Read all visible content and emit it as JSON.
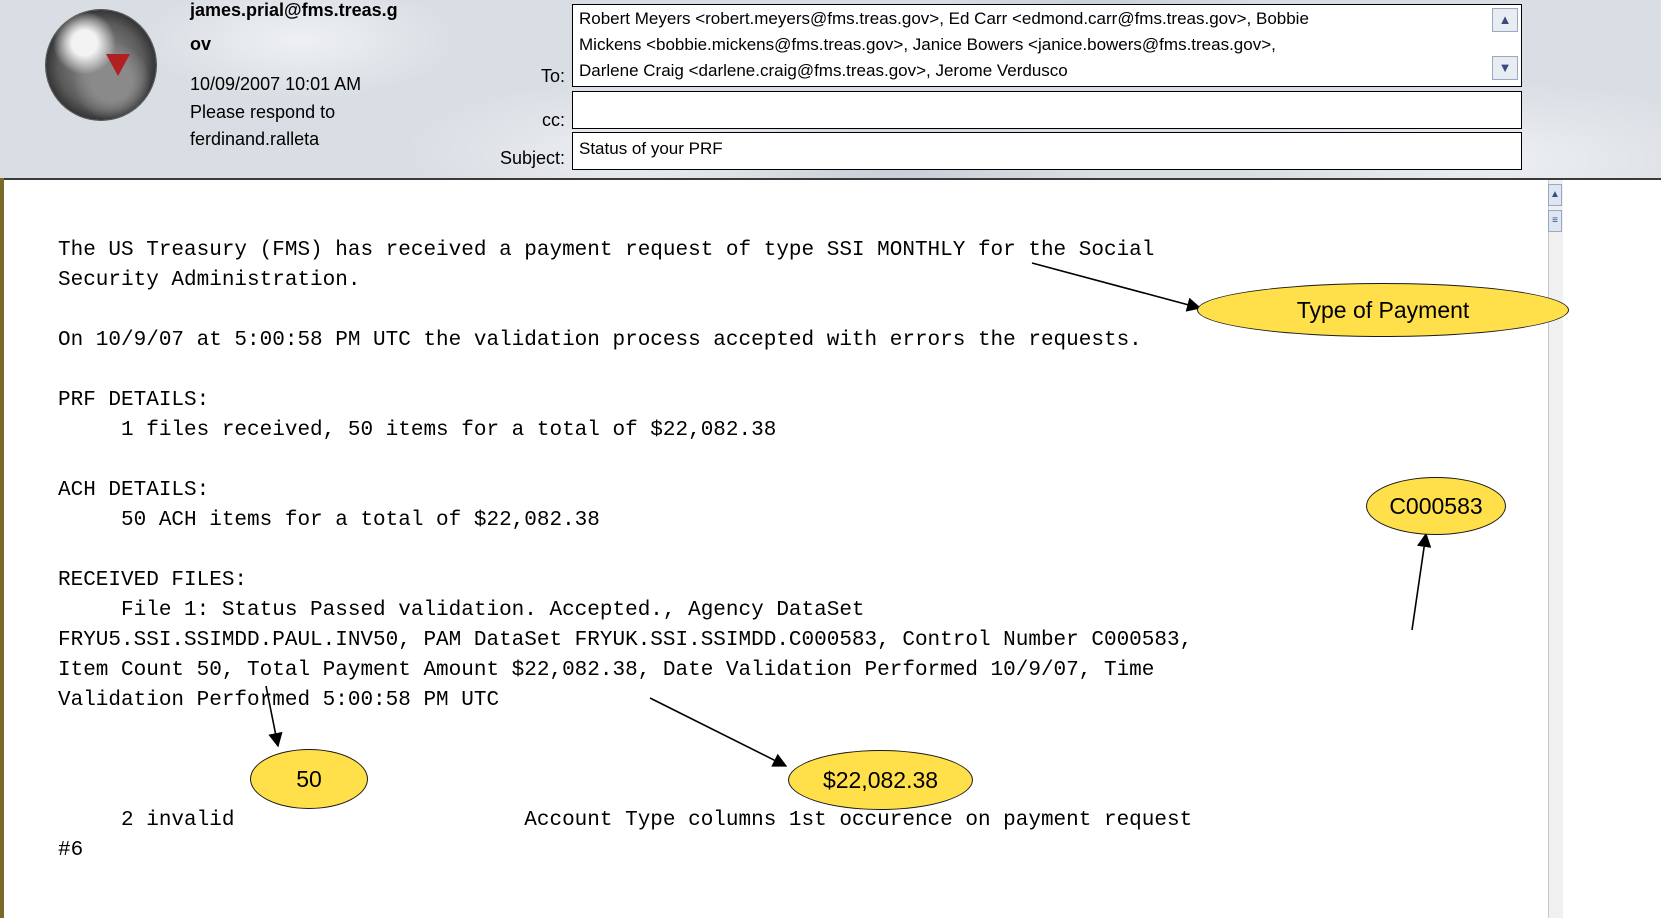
{
  "header": {
    "sender_line1": "james.prial@fms.treas.g",
    "sender_line2": "ov",
    "datetime": "10/09/2007 10:01 AM",
    "respond_to_line1": "Please respond to",
    "respond_to_line2": "ferdinand.ralleta",
    "to_label": "To:",
    "cc_label": "cc:",
    "subject_label": "Subject:",
    "to_lines": [
      "Robert Meyers <robert.meyers@fms.treas.gov>, Ed Carr <edmond.carr@fms.treas.gov>, Bobbie",
      "Mickens <bobbie.mickens@fms.treas.gov>, Janice Bowers <janice.bowers@fms.treas.gov>,",
      "Darlene Craig <darlene.craig@fms.treas.gov>, Jerome Verdusco"
    ],
    "cc_value": "",
    "subject_value": "Status of your PRF"
  },
  "message": {
    "lines": [
      "The US Treasury (FMS) has received a payment request of type SSI MONTHLY for the Social",
      "Security Administration.",
      "On 10/9/07 at 5:00:58 PM UTC the validation process accepted with errors the requests.",
      "PRF DETAILS:",
      "     1 files received, 50 items for a total of $22,082.38",
      "ACH DETAILS:",
      "     50 ACH items for a total of $22,082.38",
      "RECEIVED FILES:",
      "     File 1: Status Passed validation. Accepted., Agency DataSet",
      "FRYU5.SSI.SSIMDD.PAUL.INV50, PAM DataSet FRYUK.SSI.SSIMDD.C000583, Control Number C000583,",
      "Item Count 50, Total Payment Amount $22,082.38, Date Validation Performed 10/9/07, Time",
      "Validation Performed 5:00:58 PM UTC",
      "     2 invalid                       Account Type columns 1st occurence on payment request",
      "#6"
    ]
  },
  "callouts": {
    "type_of_payment": "Type of Payment",
    "control_number": "C000583",
    "item_count": "50",
    "amount": "$22,082.38"
  },
  "icons": {
    "scroll_up": "scroll-up-icon",
    "scroll_down": "scroll-down-icon",
    "sender_photo": "globe-avatar-icon"
  }
}
